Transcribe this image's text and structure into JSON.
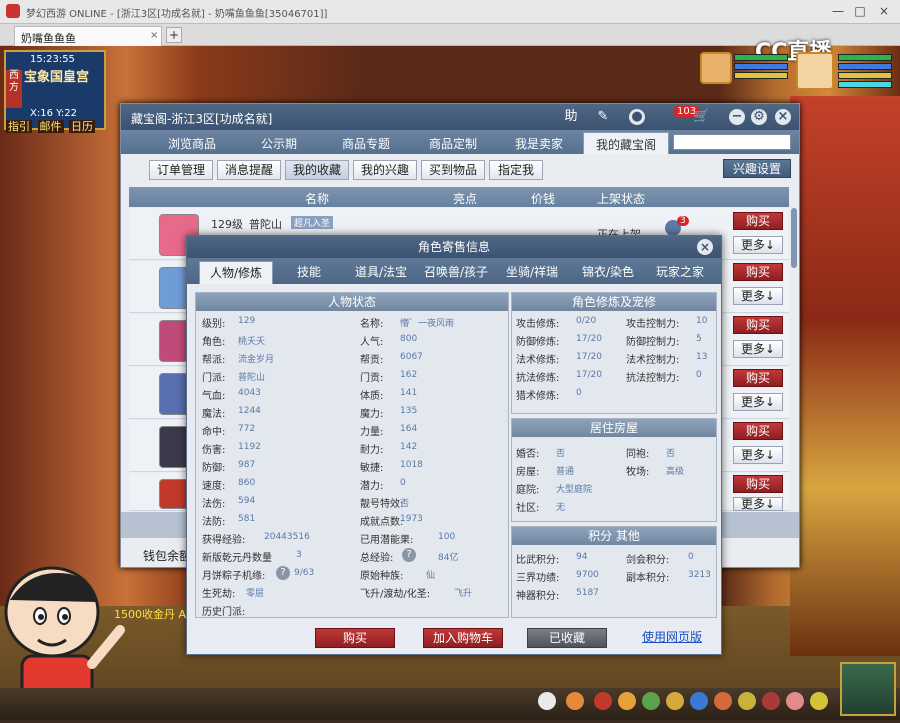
{
  "browser": {
    "title": "梦幻西游 ONLINE - [浙江3区[功成名就] - 奶嘴鱼鱼鱼[35046701]]",
    "tab_label": "奶嘴鱼鱼鱼",
    "tab_close": "×",
    "new_tab": "+",
    "win_buttons": [
      "—",
      "□",
      "×"
    ]
  },
  "game": {
    "clock": "15:23:55",
    "location": "宝象国皇宫",
    "coords": "X:16 Y:22",
    "side_badge": "西方",
    "mini_buttons": [
      "指引",
      "邮件",
      "日历"
    ],
    "stream_logo": "CC直播",
    "chat_message": "1500收金丹 A"
  },
  "shop": {
    "title": "藏宝阁-浙江3区[功成名就]",
    "header_icons": {
      "help": "助",
      "notif": "103"
    },
    "nav_tabs": [
      "浏览商品",
      "公示期",
      "商品专题",
      "商品定制",
      "我是卖家",
      "我的藏宝阁"
    ],
    "sub_tabs": [
      "订单管理",
      "消息提醒",
      "我的收藏",
      "我的兴趣",
      "买到物品",
      "指定我"
    ],
    "interest_settings": "兴趣设置",
    "columns": [
      "名称",
      "亮点",
      "价钱",
      "上架状态"
    ],
    "first_row": {
      "level": "129级",
      "school": "普陀山",
      "badge": "超凡入圣",
      "status": "正在上架",
      "count": "3"
    },
    "buy": "购买",
    "more": "更多↓",
    "wallet": "钱包余额"
  },
  "modal": {
    "title": "角色寄售信息",
    "tabs": [
      "人物/修炼",
      "技能",
      "道具/法宝",
      "召唤兽/孩子",
      "坐骑/祥瑞",
      "锦衣/染色",
      "玩家之家"
    ],
    "status_header": "人物状态",
    "left_col": [
      {
        "k": "级别:",
        "v": "129"
      },
      {
        "k": "角色:",
        "v": "桃夭夭"
      },
      {
        "k": "帮派:",
        "v": "流金岁月"
      },
      {
        "k": "门派:",
        "v": "普陀山"
      },
      {
        "k": "气血:",
        "v": "4043"
      },
      {
        "k": "魔法:",
        "v": "1244"
      },
      {
        "k": "命中:",
        "v": "772"
      },
      {
        "k": "伤害:",
        "v": "1192"
      },
      {
        "k": "防御:",
        "v": "987"
      },
      {
        "k": "速度:",
        "v": "860"
      },
      {
        "k": "法伤:",
        "v": "594"
      },
      {
        "k": "法防:",
        "v": "581"
      }
    ],
    "mid_col": [
      {
        "k": "名称:",
        "v": "懵゛一夜风雨"
      },
      {
        "k": "人气:",
        "v": "800"
      },
      {
        "k": "帮贡:",
        "v": "6067"
      },
      {
        "k": "门贡:",
        "v": "162"
      },
      {
        "k": "体质:",
        "v": "141"
      },
      {
        "k": "魔力:",
        "v": "135"
      },
      {
        "k": "力量:",
        "v": "164"
      },
      {
        "k": "耐力:",
        "v": "142"
      },
      {
        "k": "敏捷:",
        "v": "1018"
      },
      {
        "k": "潜力:",
        "v": "0"
      },
      {
        "k": "靓号特效:",
        "v": "否"
      },
      {
        "k": "成就点数:",
        "v": "1973"
      }
    ],
    "extra": {
      "exp_label": "获得经验:",
      "exp": "20443516",
      "potential_label": "已用潜能果:",
      "potential": "100",
      "qiankun_label": "新版乾元丹数量",
      "qiankun": "3",
      "total_exp_label": "总经验:",
      "total_exp": "84亿",
      "mooncake_label": "月饼粽子机缘:",
      "mooncake": "9/63",
      "race_label": "原始种族:",
      "race": "仙",
      "life_label": "生死劫:",
      "life": "零层",
      "fly_label": "飞升/渡劫/化圣:",
      "fly": "飞升",
      "history_label": "历史门派:"
    },
    "cultivation_header": "角色修炼及宠修",
    "cultivation": [
      {
        "k": "攻击修炼:",
        "v": "0/20"
      },
      {
        "k": "防御修炼:",
        "v": "17/20"
      },
      {
        "k": "法术修炼:",
        "v": "17/20"
      },
      {
        "k": "抗法修炼:",
        "v": "17/20"
      },
      {
        "k": "猎术修炼:",
        "v": "0"
      }
    ],
    "pet_control": [
      {
        "k": "攻击控制力:",
        "v": "10"
      },
      {
        "k": "防御控制力:",
        "v": "5"
      },
      {
        "k": "法术控制力:",
        "v": "13"
      },
      {
        "k": "抗法控制力:",
        "v": "0"
      }
    ],
    "house_header": "居住房屋",
    "house": [
      {
        "k": "婚否:",
        "v": "否"
      },
      {
        "k": "房屋:",
        "v": "普通"
      },
      {
        "k": "庭院:",
        "v": "大型庭院"
      },
      {
        "k": "社区:",
        "v": "无"
      }
    ],
    "house_right": [
      {
        "k": "同袍:",
        "v": "否"
      },
      {
        "k": "牧场:",
        "v": "高级"
      }
    ],
    "points_header": "积分 其他",
    "points": [
      {
        "k": "比武积分:",
        "v": "94"
      },
      {
        "k": "三界功绩:",
        "v": "9700"
      },
      {
        "k": "神器积分:",
        "v": "5187"
      }
    ],
    "points_right": [
      {
        "k": "剑会积分:",
        "v": "0"
      },
      {
        "k": "副本积分:",
        "v": "3213"
      }
    ],
    "btn_buy": "购买",
    "btn_cart": "加入购物车",
    "btn_collected": "已收藏",
    "btn_web": "使用网页版"
  },
  "colors": {
    "accent": "#3b5270",
    "buy": "#a52a2d",
    "link": "#1a4fbf"
  }
}
